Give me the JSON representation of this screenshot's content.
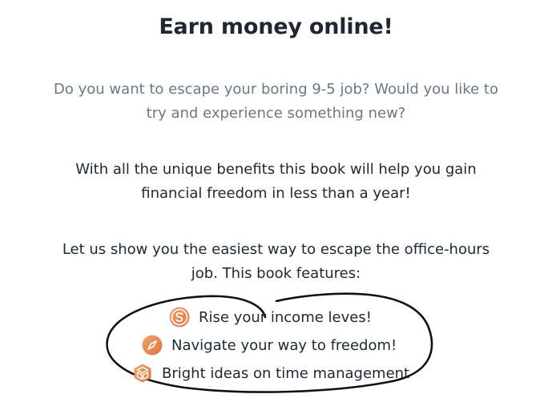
{
  "title": "Earn money online!",
  "intro": {
    "line1": "Do you want to escape your boring 9-5 job? Would you like to",
    "line2": "try and experience something new?"
  },
  "benefits": {
    "line1": "With all the unique benefits this book will help you gain",
    "line2": "financial freedom in less than a year!"
  },
  "features_intro": {
    "line1": "Let us show you the easiest way to escape the office-hours",
    "line2": "job. This book features:"
  },
  "features": [
    {
      "icon": "dollar-coin-icon",
      "label": "Rise your income leves!"
    },
    {
      "icon": "compass-icon",
      "label": "Navigate your way to freedom!"
    },
    {
      "icon": "cube-icon",
      "label": "Bright ideas on time management"
    }
  ],
  "colors": {
    "heading": "#1f2733",
    "muted_text": "#6b7888",
    "icon_accent": "#e08a4a"
  }
}
